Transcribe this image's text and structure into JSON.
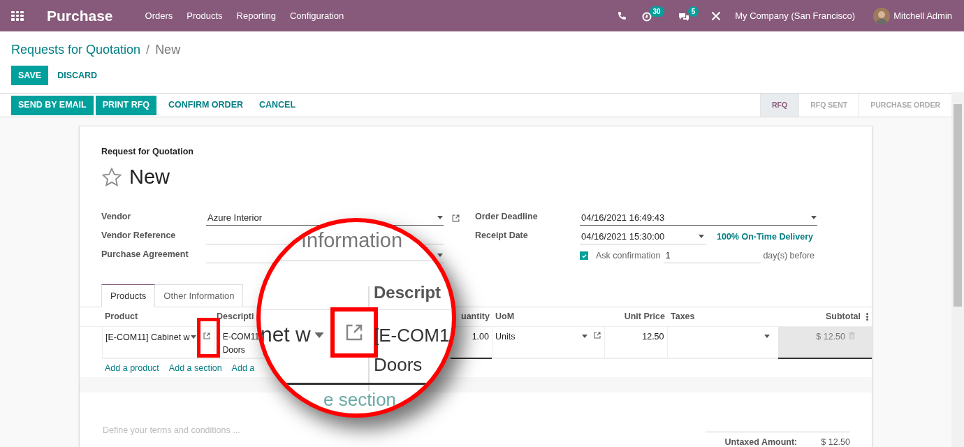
{
  "navbar": {
    "app_title": "Purchase",
    "menu": [
      "Orders",
      "Products",
      "Reporting",
      "Configuration"
    ],
    "activity_count": "30",
    "message_count": "5",
    "company": "My Company (San Francisco)",
    "user": "Mitchell Admin"
  },
  "breadcrumb": {
    "parent": "Requests for Quotation",
    "separator": "/",
    "current": "New"
  },
  "edit_buttons": [
    {
      "label": "SAVE",
      "kind": "primary"
    },
    {
      "label": "DISCARD",
      "kind": "link"
    }
  ],
  "actions": [
    {
      "label": "SEND BY EMAIL",
      "kind": "primary"
    },
    {
      "label": "PRINT RFQ",
      "kind": "primary"
    },
    {
      "label": "CONFIRM ORDER",
      "kind": "link"
    },
    {
      "label": "CANCEL",
      "kind": "link"
    }
  ],
  "status_steps": [
    {
      "label": "RFQ",
      "selected": true
    },
    {
      "label": "RFQ SENT",
      "selected": false
    },
    {
      "label": "PURCHASE ORDER",
      "selected": false
    }
  ],
  "form": {
    "subtitle": "Request for Quotation",
    "title": "New",
    "starred": false,
    "left_fields": [
      {
        "label": "Vendor",
        "value": "Azure Interior",
        "kind": "relation"
      },
      {
        "label": "Vendor Reference",
        "kind": "text"
      },
      {
        "label": "Purchase Agreement",
        "kind": "select"
      }
    ],
    "order_deadline": {
      "label": "Order Deadline",
      "value": "04/16/2021 16:49:43"
    },
    "receipt_date": {
      "label": "Receipt Date",
      "value": "04/16/2021 15:30:00",
      "link": "100% On-Time Delivery"
    },
    "ask_confirmation": {
      "checked": true,
      "label": "Ask confirmation",
      "value": "1",
      "suffix": "day(s) before"
    }
  },
  "tabs": [
    {
      "label": "Products",
      "selected": true
    },
    {
      "label": "Other Information",
      "selected": false
    }
  ],
  "table": {
    "columns": [
      "Product",
      "Descripti",
      "uantity",
      "UoM",
      "Unit Price",
      "Taxes",
      "Subtotal"
    ],
    "rows": [
      {
        "product": "[E-COM11] Cabinet w",
        "description": [
          "E-COM11",
          "Doors"
        ],
        "quantity": "1.00",
        "uom": "Units",
        "unit_price": "12.50",
        "subtotal": "$ 12.50"
      }
    ],
    "add_links": [
      "Add a product",
      "Add a section",
      "Add a"
    ]
  },
  "terms_placeholder": "Define your terms and conditions ...",
  "totals": [
    {
      "label": "Untaxed Amount:",
      "value": "$ 12.50"
    }
  ],
  "magnifier": {
    "tab_text": "Information",
    "column_text": "Descript",
    "product_text": "net w",
    "description_lines": [
      "[E-COM1",
      "Doors"
    ],
    "link_text": "e section"
  }
}
